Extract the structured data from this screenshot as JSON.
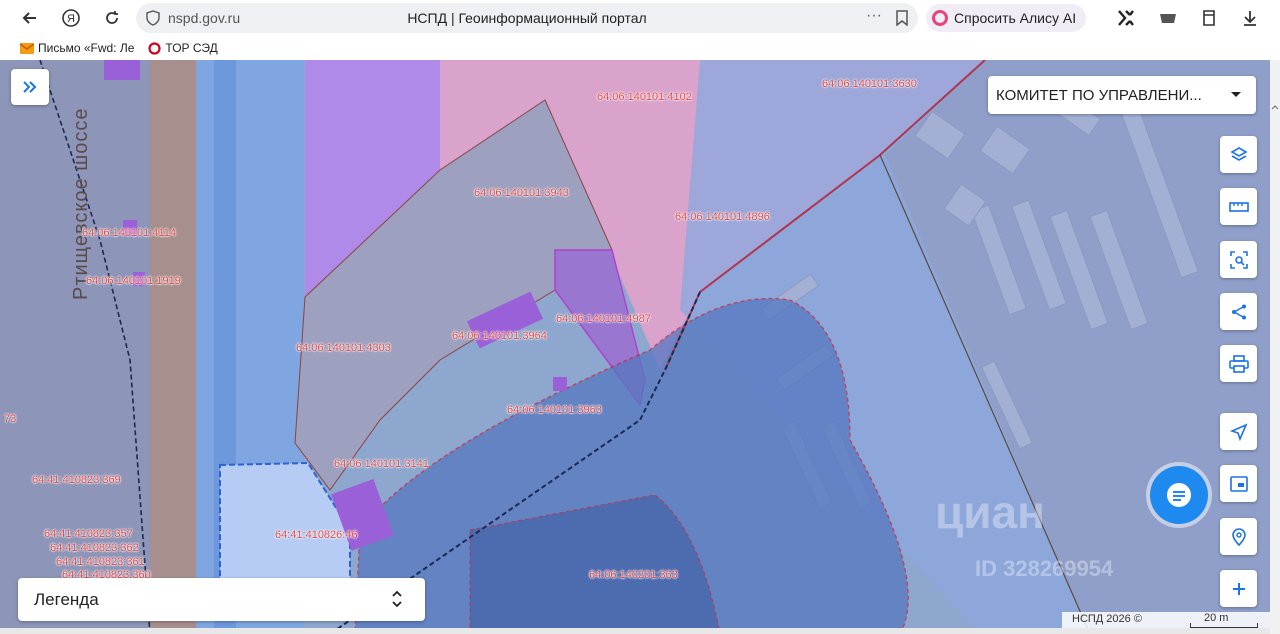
{
  "browser": {
    "url_domain": "nspd.gov.ru",
    "page_title": "НСПД | Геоинформационный портал",
    "alisa_label": "Спросить Алису AI",
    "more_label": "···"
  },
  "bookmarks": [
    {
      "label": "Письмо «Fwd: Ле"
    },
    {
      "label": "ТОР СЭД"
    }
  ],
  "map": {
    "layer_select": "КОМИТЕТ ПО УПРАВЛЕНИ...",
    "legend_label": "Легенда",
    "road_name": "Ртищевское шоссе",
    "copyright": "НСПД 2026 ©",
    "scale": "20 m",
    "watermark": "циан",
    "watermark_id": "ID 328269954",
    "parcels": [
      {
        "id": "64:06:140101:4102"
      },
      {
        "id": "64:06:140101:3630"
      },
      {
        "id": "64:06:140101:3943"
      },
      {
        "id": "64:06:140101:4896"
      },
      {
        "id": "64:06:140101:4114"
      },
      {
        "id": "64:06:140101:1919"
      },
      {
        "id": "64:06:140101:4987"
      },
      {
        "id": "64:06:140101:3964"
      },
      {
        "id": "64:06:140101:4303"
      },
      {
        "id": "64:06:140101:3963"
      },
      {
        "id": "64:06:140101:3141"
      },
      {
        "id": "64:41:410823:369"
      },
      {
        "id": "64:41:410826:46"
      },
      {
        "id": "64:41:410823:357"
      },
      {
        "id": "64:41:410823:362"
      },
      {
        "id": "64:41:410823:361"
      },
      {
        "id": "64:41:410823:360"
      },
      {
        "id": "64:06:140201:363"
      },
      {
        "id": "73"
      }
    ]
  },
  "colors": {
    "accent": "#1a73e8",
    "parcel_label": "#e04848",
    "purple_zone": "#b08ae8",
    "pink_zone": "#d9a3cc",
    "blue_zone": "#5577c0"
  }
}
